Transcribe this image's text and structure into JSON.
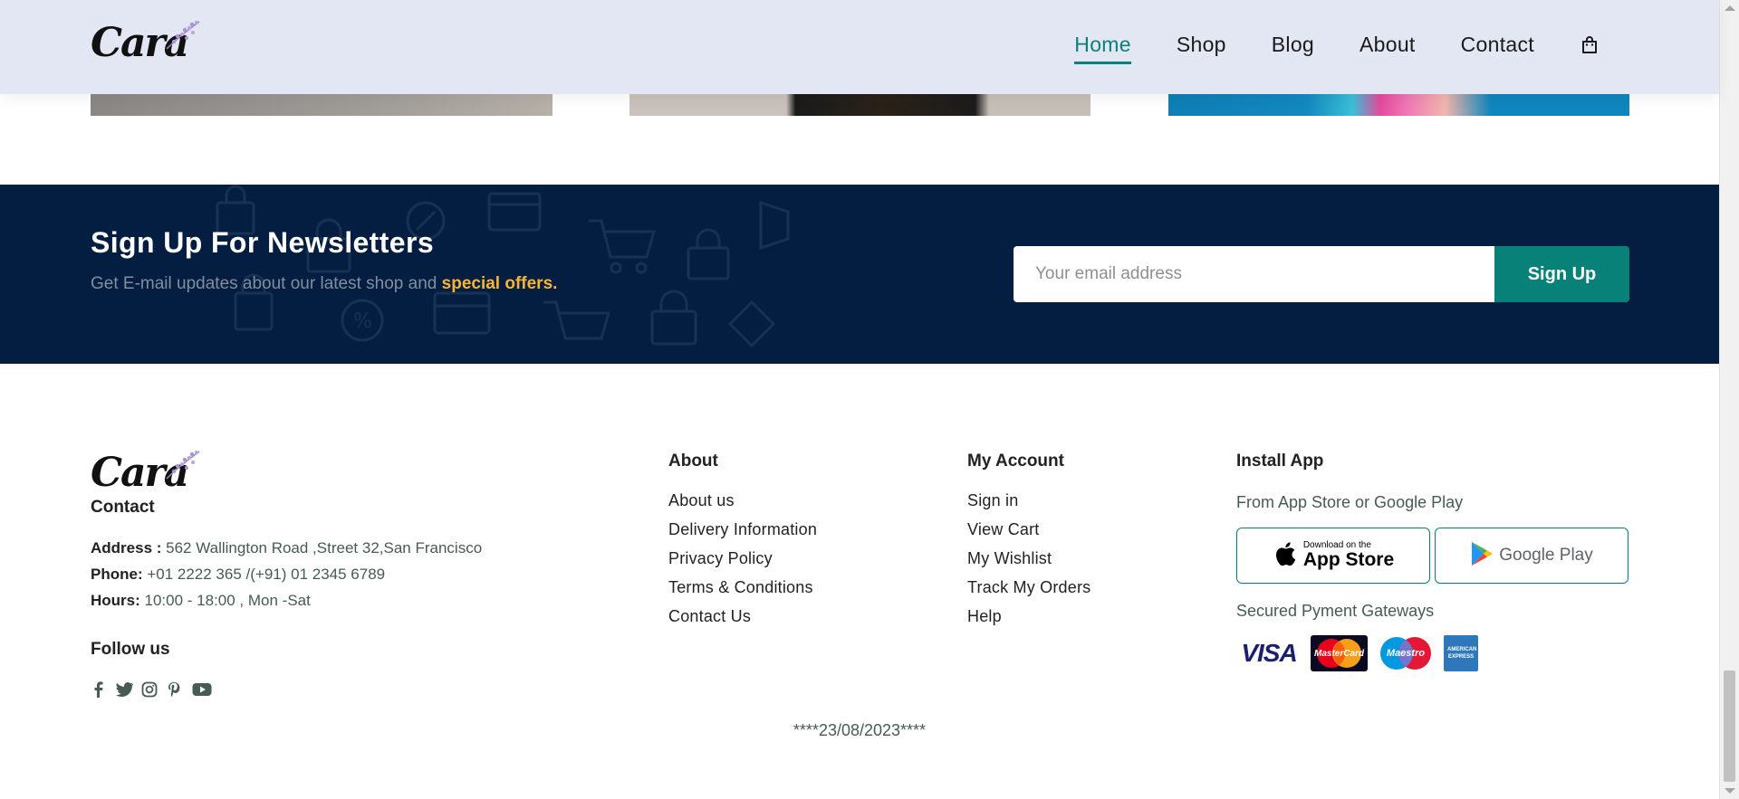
{
  "header": {
    "logo_text": "Cara",
    "nav": [
      {
        "label": "Home",
        "active": true
      },
      {
        "label": "Shop",
        "active": false
      },
      {
        "label": "Blog",
        "active": false
      },
      {
        "label": "About",
        "active": false
      },
      {
        "label": "Contact",
        "active": false
      }
    ],
    "cart_icon": "shopping-bag-icon"
  },
  "newsletter": {
    "title": "Sign Up For Newsletters",
    "subtitle_prefix": "Get E-mail updates about our latest shop and ",
    "subtitle_highlight": "special offers.",
    "email_placeholder": "Your email address",
    "button_label": "Sign Up"
  },
  "footer": {
    "logo_text": "Cara",
    "contact": {
      "heading": "Contact",
      "address_label": "Address :",
      "address_value": " 562 Wallington Road ,Street 32,San Francisco",
      "phone_label": "Phone:",
      "phone_value": " +01 2222 365 /(+91) 01 2345 6789",
      "hours_label": "Hours:",
      "hours_value": " 10:00 - 18:00 , Mon -Sat"
    },
    "follow": {
      "heading": "Follow us",
      "icons": [
        "facebook-icon",
        "twitter-icon",
        "instagram-icon",
        "pinterest-icon",
        "youtube-icon"
      ]
    },
    "about": {
      "heading": "About",
      "links": [
        "About us",
        "Delivery Information",
        "Privacy Policy",
        "Terms & Conditions",
        "Contact Us"
      ]
    },
    "account": {
      "heading": "My Account",
      "links": [
        "Sign in",
        "View Cart",
        "My Wishlist",
        "Track My Orders",
        "Help"
      ]
    },
    "install": {
      "heading": "Install App",
      "subtitle": "From App Store or Google Play",
      "app_store_small": "Download on the",
      "app_store_big": "App Store",
      "google_play": "Google Play",
      "payments_label": "Secured Pyment Gateways",
      "payments": [
        "VISA",
        "MasterCard",
        "Maestro",
        "AMERICAN EXPRESS"
      ]
    },
    "date": "****23/08/2023****"
  },
  "colors": {
    "accent": "#088178",
    "header_bg": "#e3e6f3",
    "newsletter_bg": "#041e42",
    "highlight": "#f9b532"
  }
}
